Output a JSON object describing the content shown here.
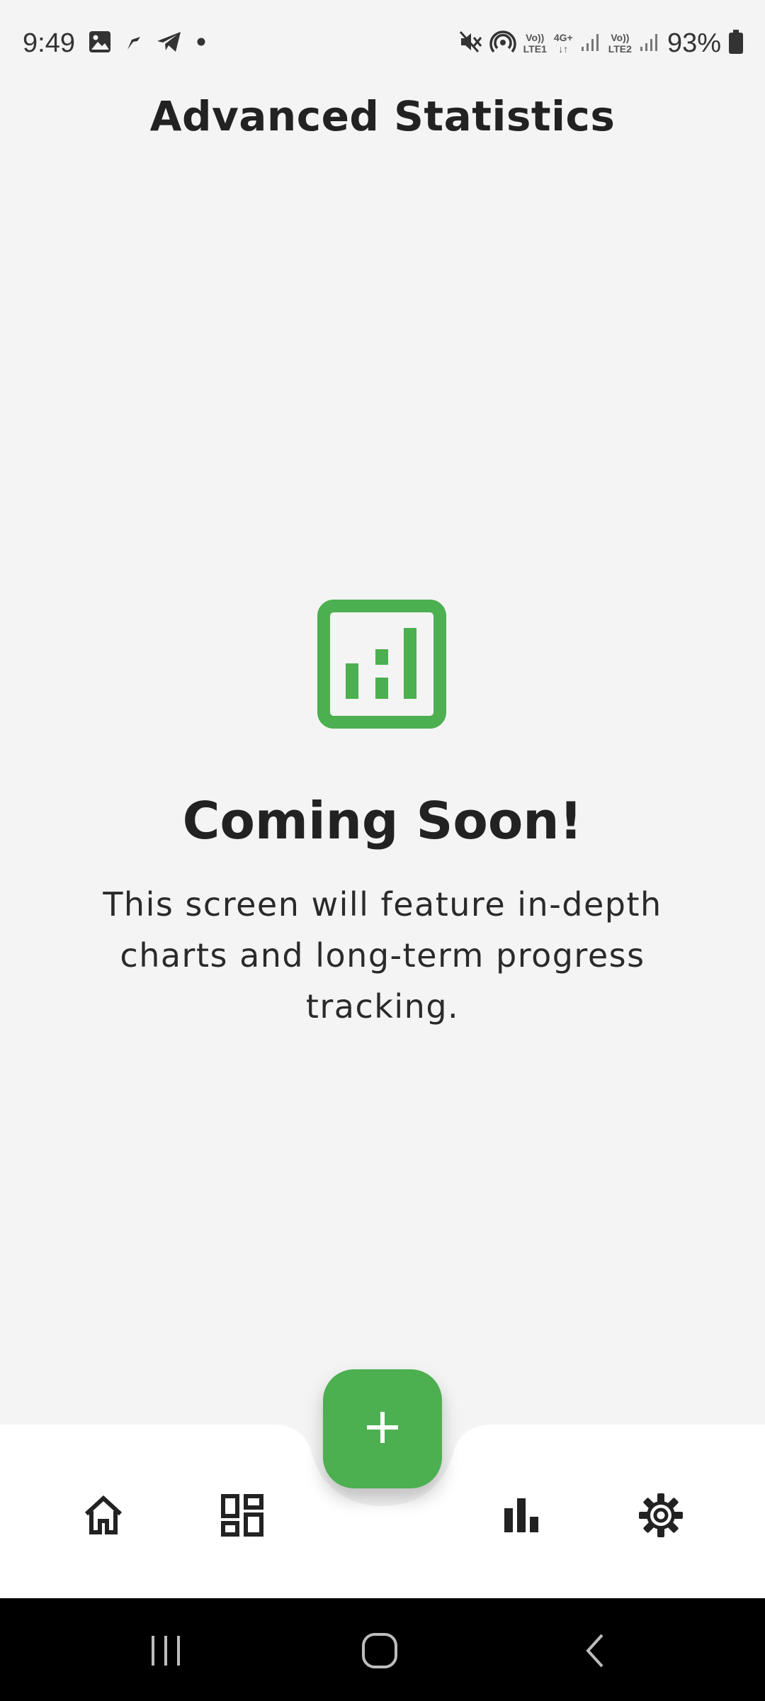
{
  "status_bar": {
    "time": "9:49",
    "battery_percent": "93%",
    "sim1_label_top": "Vo))",
    "sim1_label_bottom": "LTE1",
    "network_type": "4G+",
    "sim2_label_top": "Vo))",
    "sim2_label_bottom": "LTE2",
    "icons": [
      "gallery-icon",
      "flipboard-icon",
      "telegram-icon",
      "dot-icon",
      "mute-icon",
      "hotspot-icon",
      "signal-icon",
      "battery-icon"
    ]
  },
  "header": {
    "title": "Advanced Statistics"
  },
  "placeholder": {
    "icon": "bar-chart-box-icon",
    "title": "Coming Soon!",
    "description": "This screen will feature in-depth charts and long-term progress tracking."
  },
  "bottom_nav": {
    "items": [
      {
        "icon": "home-icon"
      },
      {
        "icon": "dashboard-icon"
      },
      {
        "icon": "bar-chart-icon"
      },
      {
        "icon": "settings-icon"
      }
    ],
    "fab_icon": "plus-icon"
  },
  "system_nav": {
    "icons": [
      "recents-icon",
      "home-circle-icon",
      "back-icon"
    ]
  },
  "colors": {
    "accent": "#4caf50",
    "background": "#f4f4f4",
    "nav_background": "#ffffff",
    "text_primary": "#222222",
    "system_bar": "#000000"
  }
}
